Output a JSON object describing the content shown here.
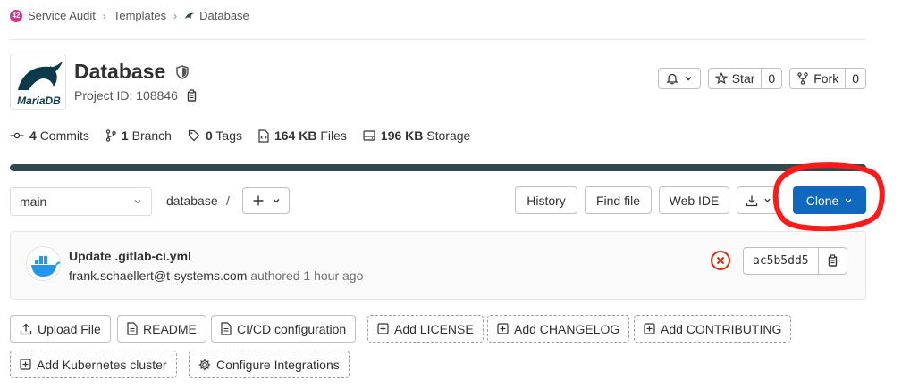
{
  "breadcrumb": {
    "group_badge": "42",
    "group": "Service Audit",
    "templates": "Templates",
    "project": "Database"
  },
  "project": {
    "name": "Database",
    "id_text": "Project ID: 108846",
    "logo_text": "MariaDB"
  },
  "header_actions": {
    "star_label": "Star",
    "star_count": "0",
    "fork_label": "Fork",
    "fork_count": "0"
  },
  "stats": {
    "commits_count": "4",
    "commits_label": "Commits",
    "branch_count": "1",
    "branch_label": "Branch",
    "tags_count": "0",
    "tags_label": "Tags",
    "files_size": "164 KB",
    "files_label": "Files",
    "storage_size": "196 KB",
    "storage_label": "Storage"
  },
  "toolbar": {
    "branch": "main",
    "path": "database",
    "path_sep": "/",
    "history": "History",
    "find_file": "Find file",
    "web_ide": "Web IDE",
    "clone": "Clone"
  },
  "commit": {
    "title": "Update .gitlab-ci.yml",
    "author": "frank.schaellert@t-systems.com",
    "authored": "authored 1 hour ago",
    "sha": "ac5b5dd5"
  },
  "quick_actions": {
    "upload": "Upload File",
    "readme": "README",
    "cicd": "CI/CD configuration",
    "license": "Add LICENSE",
    "changelog": "Add CHANGELOG",
    "contributing": "Add CONTRIBUTING",
    "kubernetes": "Add Kubernetes cluster",
    "integrations": "Configure Integrations"
  },
  "colors": {
    "primary": "#1068bf",
    "language_bar": "#2f4a4f",
    "annotation": "#ff1a1a",
    "failed": "#dd2b0e",
    "group_badge": "#d5338a"
  }
}
